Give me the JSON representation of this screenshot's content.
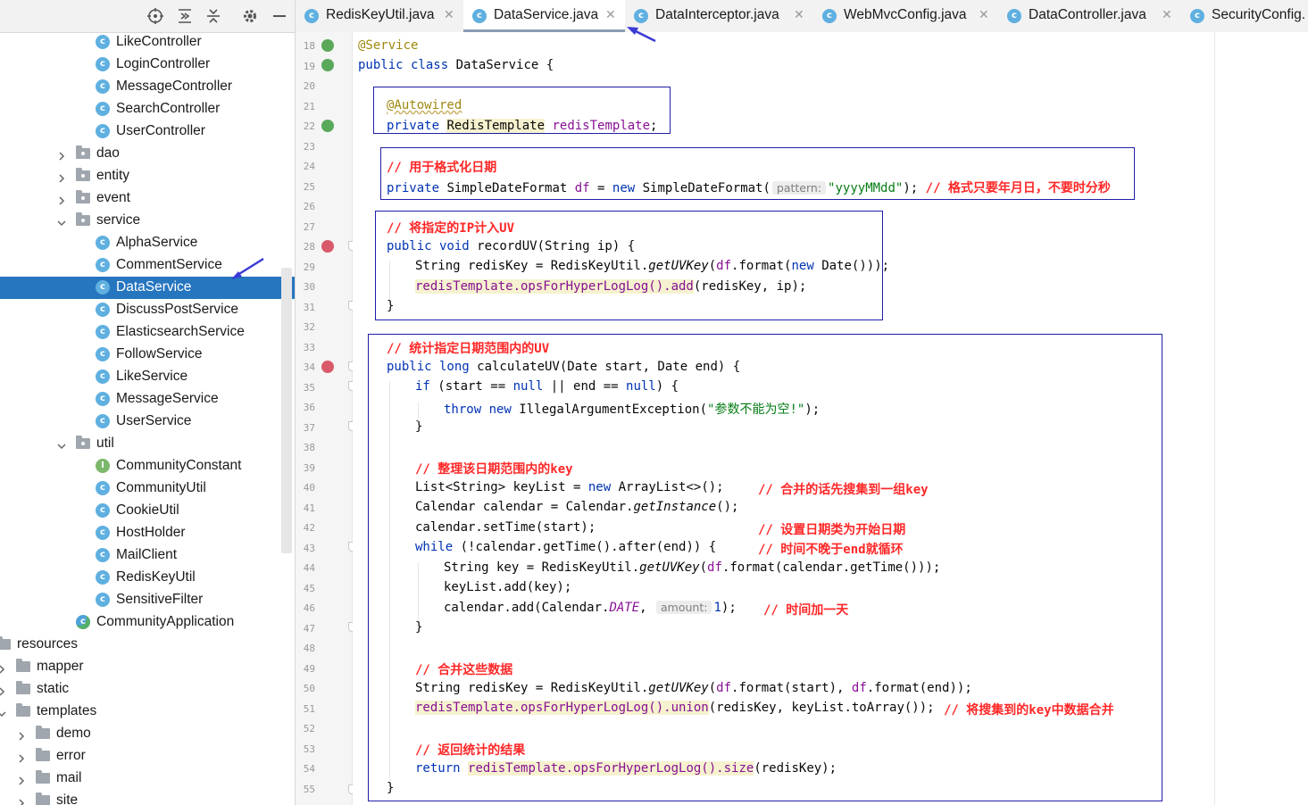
{
  "colors": {
    "selection": "#2675bf",
    "annotation_box": "#1e1ea8",
    "comment": "#ff2828",
    "keyword": "#0033b3",
    "arrow": "#3a3ad6"
  },
  "sidebar": {
    "toolbar": {
      "icons": [
        "locate-icon",
        "expand-all-icon",
        "collapse-all-icon",
        "gear-icon",
        "minimize-icon"
      ]
    },
    "items": [
      {
        "label": "LikeController",
        "type": "class"
      },
      {
        "label": "LoginController",
        "type": "class"
      },
      {
        "label": "MessageController",
        "type": "class"
      },
      {
        "label": "SearchController",
        "type": "class"
      },
      {
        "label": "UserController",
        "type": "class"
      },
      {
        "label": "dao",
        "type": "package"
      },
      {
        "label": "entity",
        "type": "package"
      },
      {
        "label": "event",
        "type": "package"
      },
      {
        "label": "service",
        "type": "package"
      },
      {
        "label": "AlphaService",
        "type": "class"
      },
      {
        "label": "CommentService",
        "type": "class"
      },
      {
        "label": "DataService",
        "type": "class"
      },
      {
        "label": "DiscussPostService",
        "type": "class"
      },
      {
        "label": "ElasticsearchService",
        "type": "class"
      },
      {
        "label": "FollowService",
        "type": "class"
      },
      {
        "label": "LikeService",
        "type": "class"
      },
      {
        "label": "MessageService",
        "type": "class"
      },
      {
        "label": "UserService",
        "type": "class"
      },
      {
        "label": "util",
        "type": "package"
      },
      {
        "label": "CommunityConstant",
        "type": "interface"
      },
      {
        "label": "CommunityUtil",
        "type": "class"
      },
      {
        "label": "CookieUtil",
        "type": "class"
      },
      {
        "label": "HostHolder",
        "type": "class"
      },
      {
        "label": "MailClient",
        "type": "class"
      },
      {
        "label": "RedisKeyUtil",
        "type": "class"
      },
      {
        "label": "SensitiveFilter",
        "type": "class"
      },
      {
        "label": "CommunityApplication",
        "type": "app"
      },
      {
        "label": "resources",
        "type": "folder"
      },
      {
        "label": "mapper",
        "type": "folder"
      },
      {
        "label": "static",
        "type": "folder"
      },
      {
        "label": "templates",
        "type": "folder"
      },
      {
        "label": "demo",
        "type": "folder"
      },
      {
        "label": "error",
        "type": "folder"
      },
      {
        "label": "mail",
        "type": "folder"
      },
      {
        "label": "site",
        "type": "folder"
      }
    ]
  },
  "tabs": [
    {
      "label": "RedisKeyUtil.java",
      "active": false
    },
    {
      "label": "DataService.java",
      "active": true
    },
    {
      "label": "DataInterceptor.java",
      "active": false
    },
    {
      "label": "WebMvcConfig.java",
      "active": false
    },
    {
      "label": "DataController.java",
      "active": false
    },
    {
      "label": "SecurityConfig.",
      "active": false
    }
  ],
  "editor": {
    "line_numbers": [
      "18",
      "19",
      "20",
      "21",
      "22",
      "23",
      "24",
      "25",
      "26",
      "27",
      "28",
      "29",
      "30",
      "31",
      "32",
      "33",
      "34",
      "35",
      "36",
      "37",
      "38",
      "39",
      "40",
      "41",
      "42",
      "43",
      "44",
      "45",
      "46",
      "47",
      "48",
      "49",
      "50",
      "51",
      "52",
      "53",
      "54",
      "55"
    ],
    "code": {
      "l18": "@Service",
      "l19_kw": "public class",
      "l19_rest": " DataService {",
      "l21": "@Autowired",
      "l22_kw": "private",
      "l22_type": "RedisTemplate",
      "l22_field": "redisTemplate",
      "l24": "// 用于格式化日期",
      "l25_kw": "private",
      "l25_a": " SimpleDateFormat ",
      "l25_field": "df",
      "l25_b": " = ",
      "l25_new": "new",
      "l25_c": " SimpleDateFormat(",
      "l25_hint": "pattern:",
      "l25_str": "\"yyyyMMdd\"",
      "l25_d": "); ",
      "l25_cmt": "// 格式只要年月日，不要时分秒",
      "l27": "// 将指定的IP计入UV",
      "l28_kw": "public void",
      "l28_rest": " recordUV(String ip) {",
      "l29_a": "String redisKey = RedisKeyUtil.",
      "l29_m": "getUVKey",
      "l29_b": "(",
      "l29_f": "df",
      "l29_c": ".format(",
      "l29_new": "new",
      "l29_d": " Date()));",
      "l30_hl": "redisTemplate.opsForHyperLogLog().add",
      "l30_rest": "(redisKey, ip);",
      "brace": "}",
      "l33": "// 统计指定日期范围内的UV",
      "l34_kw": "public long",
      "l34_rest": " calculateUV(Date start, Date end) {",
      "l35_if": "if",
      "l35_a": " (start == ",
      "l35_null1": "null",
      "l35_b": " || end == ",
      "l35_null2": "null",
      "l35_c": ") {",
      "l36_kw": "throw new",
      "l36_a": " IllegalArgumentException(",
      "l36_str": "\"参数不能为空!\"",
      "l36_b": ");",
      "l39": "// 整理该日期范围内的key",
      "l40_a": "List<String> keyList = ",
      "l40_new": "new",
      "l40_b": " ArrayList<>();",
      "l40_cmt": "// 合并的话先搜集到一组key",
      "l41_a": "Calendar calendar = Calendar.",
      "l41_m": "getInstance",
      "l41_b": "();",
      "l42": "calendar.setTime(start);",
      "l42_cmt": "// 设置日期类为开始日期",
      "l43_kw": "while",
      "l43_a": " (!calendar.getTime().after(end)) {",
      "l43_cmt": "// 时间不晚于end就循环",
      "l44_a": "String key = RedisKeyUtil.",
      "l44_m": "getUVKey",
      "l44_b": "(",
      "l44_f": "df",
      "l44_c": ".format(calendar.getTime()));",
      "l45": "keyList.add(key);",
      "l46_a": "calendar.add(Calendar.",
      "l46_const": "DATE",
      "l46_b": ", ",
      "l46_hint": "amount:",
      "l46_num": "1",
      "l46_c": ");",
      "l46_cmt": "// 时间加一天",
      "l49": "// 合并这些数据",
      "l50_a": "String redisKey = RedisKeyUtil.",
      "l50_m": "getUVKey",
      "l50_b": "(",
      "l50_f1": "df",
      "l50_c": ".format(start), ",
      "l50_f2": "df",
      "l50_d": ".format(end));",
      "l51_hl": "redisTemplate.opsForHyperLogLog().union",
      "l51_rest": "(redisKey, keyList.toArray());",
      "l51_cmt": "// 将搜集到的key中数据合并",
      "l53": "// 返回统计的结果",
      "l54_kw": "return",
      "l54_hl": "redisTemplate.opsForHyperLogLog().size",
      "l54_rest": "(redisKey);"
    }
  }
}
